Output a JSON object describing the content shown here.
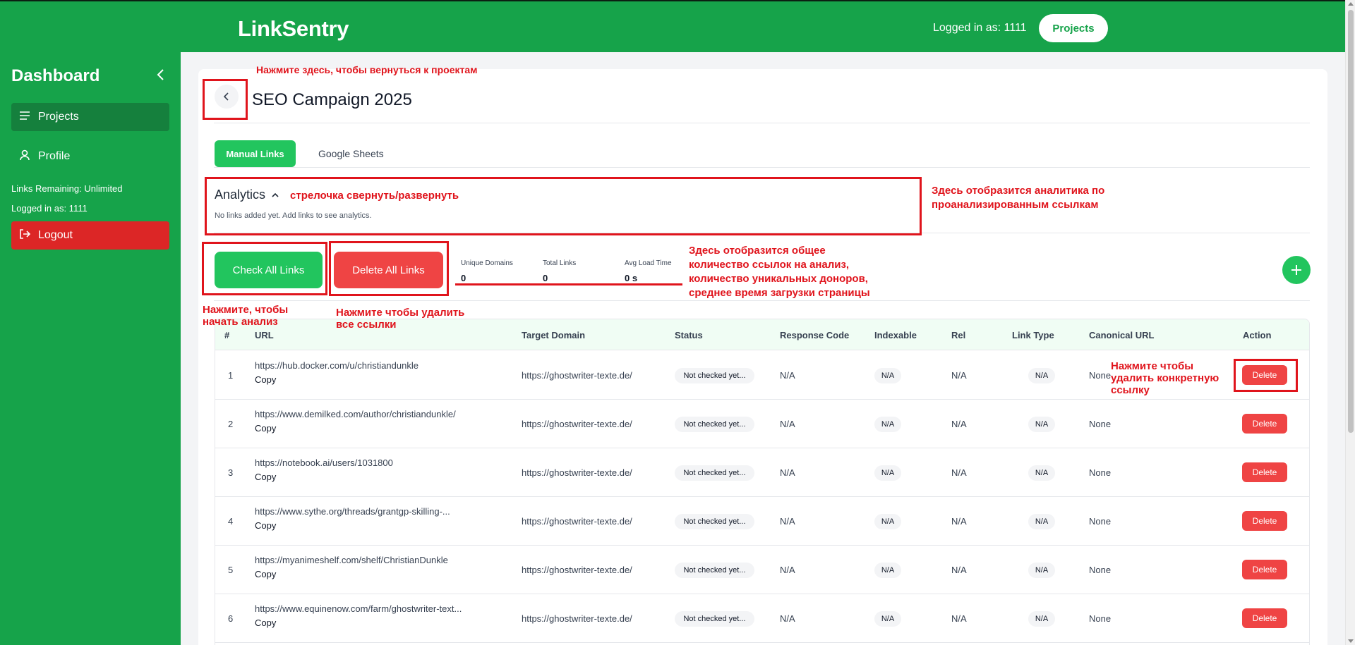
{
  "header": {
    "brand": "LinkSentry",
    "logged_in": "Logged in as: 1111",
    "projects_button": "Projects"
  },
  "sidebar": {
    "title": "Dashboard",
    "items": [
      {
        "label": "Projects",
        "icon": "menu-icon"
      },
      {
        "label": "Profile",
        "icon": "user-icon"
      }
    ],
    "links_remaining": "Links Remaining: Unlimited",
    "logged_in": "Logged in as: 1111",
    "logout": "Logout"
  },
  "page": {
    "title": "SEO Campaign 2025",
    "tabs": [
      "Manual Links",
      "Google Sheets"
    ],
    "analytics": {
      "title": "Analytics",
      "empty": "No links added yet. Add links to see analytics."
    },
    "actions": {
      "check_all": "Check All Links",
      "delete_all": "Delete All Links"
    },
    "stats": [
      {
        "label": "Unique Domains",
        "value": "0"
      },
      {
        "label": "Total Links",
        "value": "0"
      },
      {
        "label": "Avg Load Time",
        "value": "0 s"
      }
    ]
  },
  "table": {
    "headers": [
      "#",
      "URL",
      "Target Domain",
      "Status",
      "Response Code",
      "Indexable",
      "Rel",
      "Link Type",
      "Canonical URL",
      "Action"
    ],
    "copy_label": "Copy",
    "delete_label": "Delete",
    "rows": [
      {
        "num": "1",
        "url": "https://hub.docker.com/u/christiandunkle",
        "target": "https://ghostwriter-texte.de/",
        "status": "Not checked yet...",
        "response": "N/A",
        "indexable": "N/A",
        "rel": "N/A",
        "link_type": "N/A",
        "canonical": "None"
      },
      {
        "num": "2",
        "url": "https://www.demilked.com/author/christiandunkle/",
        "target": "https://ghostwriter-texte.de/",
        "status": "Not checked yet...",
        "response": "N/A",
        "indexable": "N/A",
        "rel": "N/A",
        "link_type": "N/A",
        "canonical": "None"
      },
      {
        "num": "3",
        "url": "https://notebook.ai/users/1031800",
        "target": "https://ghostwriter-texte.de/",
        "status": "Not checked yet...",
        "response": "N/A",
        "indexable": "N/A",
        "rel": "N/A",
        "link_type": "N/A",
        "canonical": "None"
      },
      {
        "num": "4",
        "url": "https://www.sythe.org/threads/grantgp-skilling-...",
        "target": "https://ghostwriter-texte.de/",
        "status": "Not checked yet...",
        "response": "N/A",
        "indexable": "N/A",
        "rel": "N/A",
        "link_type": "N/A",
        "canonical": "None"
      },
      {
        "num": "5",
        "url": "https://myanimeshelf.com/shelf/ChristianDunkle",
        "target": "https://ghostwriter-texte.de/",
        "status": "Not checked yet...",
        "response": "N/A",
        "indexable": "N/A",
        "rel": "N/A",
        "link_type": "N/A",
        "canonical": "None"
      },
      {
        "num": "6",
        "url": "https://www.equinenow.com/farm/ghostwriter-text...",
        "target": "https://ghostwriter-texte.de/",
        "status": "Not checked yet...",
        "response": "N/A",
        "indexable": "N/A",
        "rel": "N/A",
        "link_type": "N/A",
        "canonical": "None"
      }
    ]
  },
  "annotations": {
    "back": "Нажмите здесь, чтобы вернуться к проектам",
    "arrow": "стрелочка свернуть/развернуть",
    "analytics": "Здесь отобразится аналитика по проанализированным ссылкам",
    "stats": "Здесь отобразится общее количество ссылок на анализ, количество уникальных доноров, среднее время загрузки страницы",
    "check": "Нажмите, чтобы начать анализ",
    "delete_all": "Нажмите чтобы удалить все ссылки",
    "delete_one": "Нажмите чтобы удалить конкретную ссылку",
    "color": "#e0141c"
  }
}
